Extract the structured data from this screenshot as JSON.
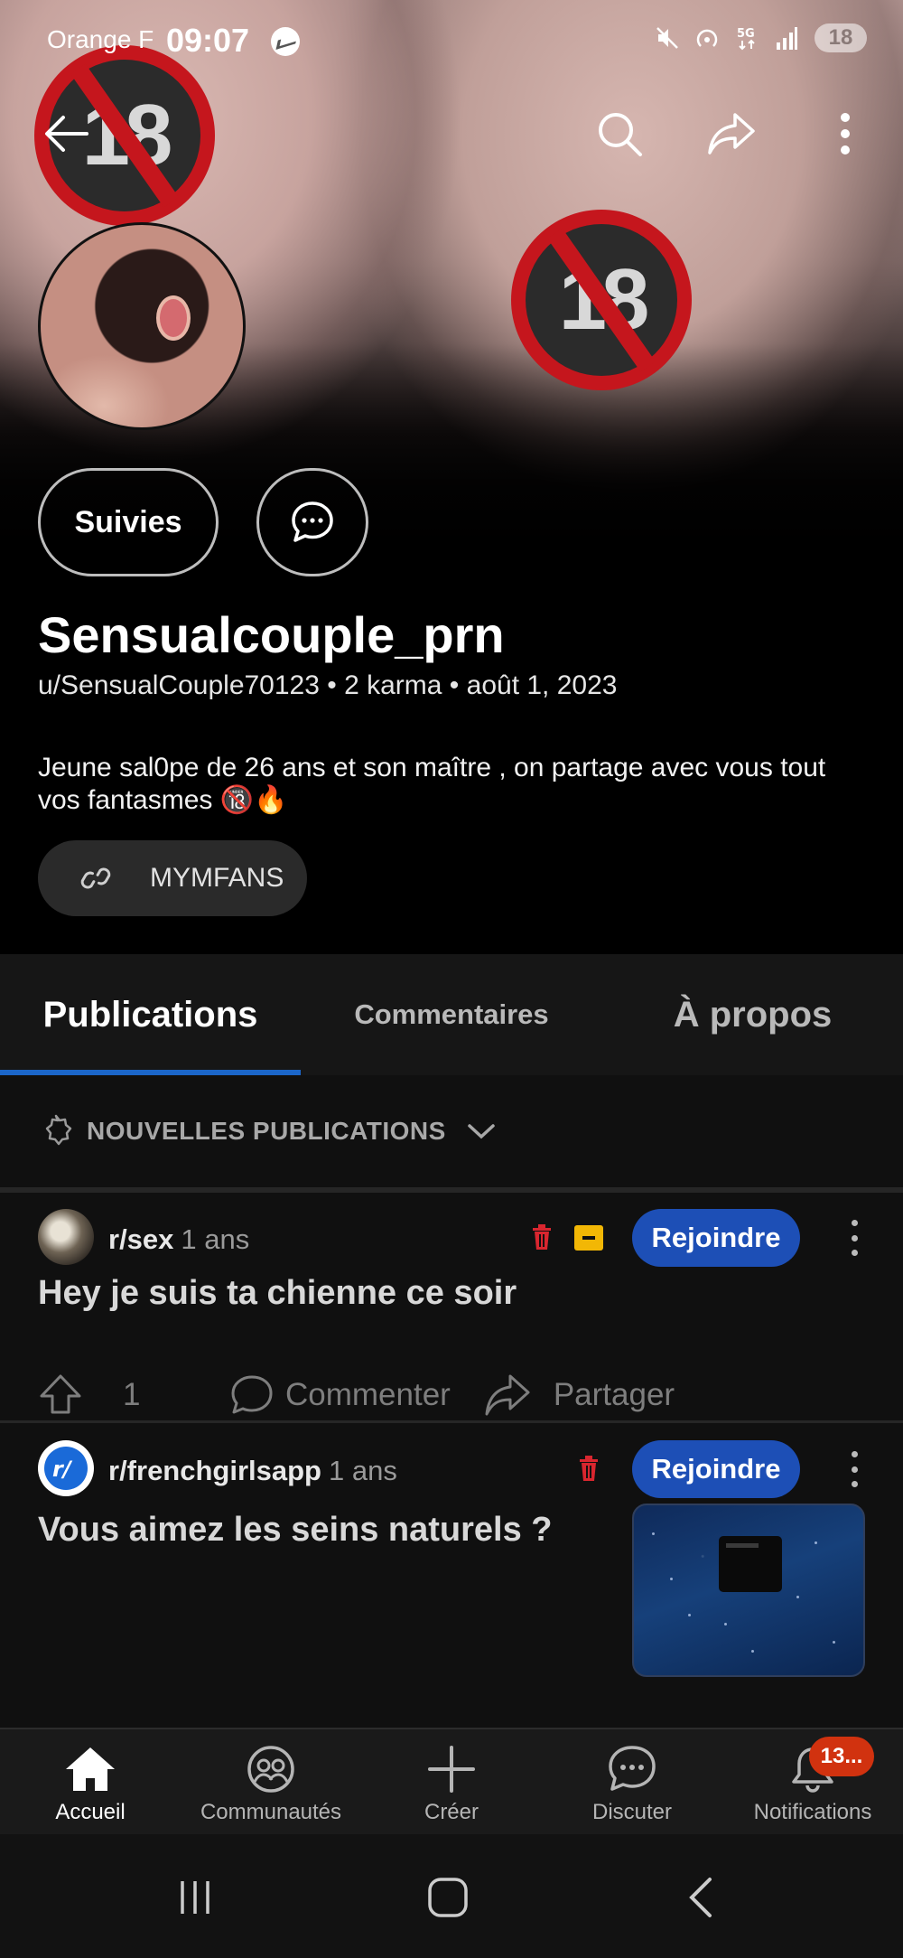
{
  "status_bar": {
    "carrier": "Orange F",
    "time": "09:07",
    "battery": "18"
  },
  "profile": {
    "display_name": "Sensualcouple_prn",
    "meta": "u/SensualCouple70123 • 2 karma • août 1, 2023",
    "bio": "Jeune sal0pe de 26 ans et son maître , on partage avec vous tout vos fantasmes 🔞🔥",
    "follow_label": "Suivies",
    "link_label": "MYMFANS",
    "badge_text": "18"
  },
  "tabs": [
    {
      "label": "Publications",
      "active": true
    },
    {
      "label": "Commentaires",
      "active": false
    },
    {
      "label": "À propos",
      "active": false
    }
  ],
  "sort": {
    "label": "NOUVELLES PUBLICATIONS"
  },
  "posts": [
    {
      "subreddit": "r/sex",
      "age": "1 ans",
      "join_label": "Rejoindre",
      "title": "Hey je suis ta chienne ce soir",
      "votes": "1",
      "comment_label": "Commenter",
      "share_label": "Partager"
    },
    {
      "subreddit": "r/frenchgirlsapp",
      "age": "1 ans",
      "join_label": "Rejoindre",
      "title": "Vous aimez les seins naturels ?"
    }
  ],
  "bottom_nav": [
    {
      "label": "Accueil",
      "icon": "home-icon",
      "active": true
    },
    {
      "label": "Communautés",
      "icon": "communities-icon",
      "active": false
    },
    {
      "label": "Créer",
      "icon": "plus-icon",
      "active": false
    },
    {
      "label": "Discuter",
      "icon": "chat-icon",
      "active": false
    },
    {
      "label": "Notifications",
      "icon": "bell-icon",
      "active": false
    }
  ],
  "notifications_badge": "13...",
  "colors": {
    "accent": "#1b66c9",
    "join_button": "#1d4fb6",
    "notification_badge": "#d1320f",
    "trash": "#d9262f",
    "archive": "#f2b705"
  }
}
